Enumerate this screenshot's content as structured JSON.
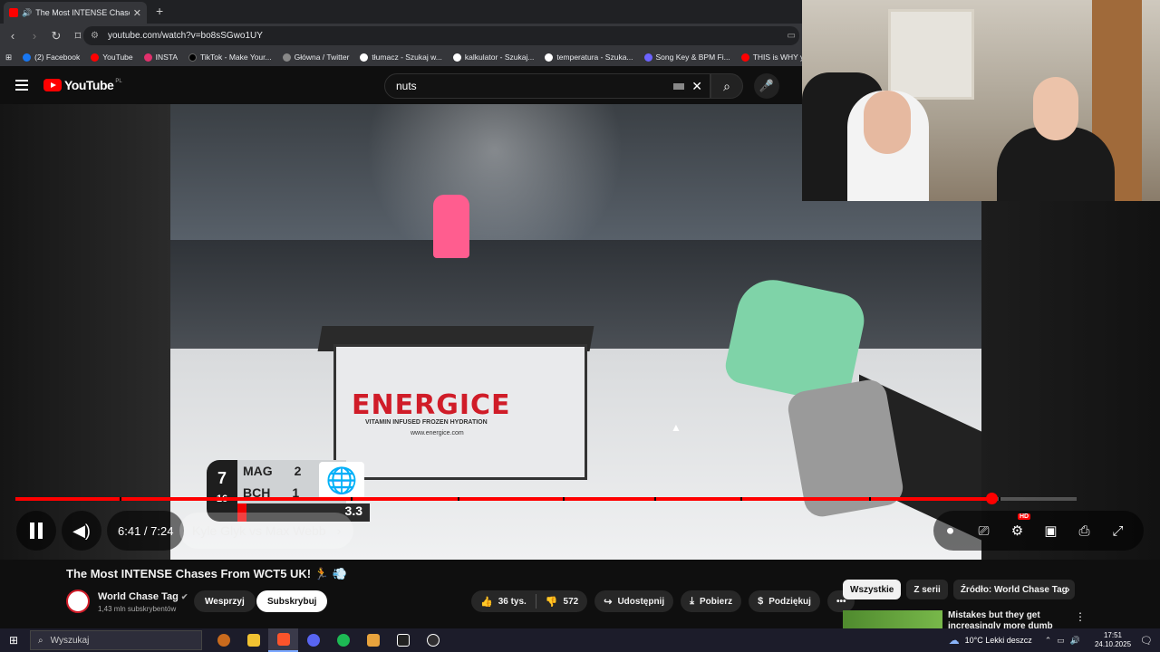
{
  "browser": {
    "tab_title": "The Most INTENSE Chases Fr",
    "url": "youtube.com/watch?v=bo8sSGwo1UY",
    "bookmarks": [
      {
        "label": "(2) Facebook",
        "color": "#1877f2"
      },
      {
        "label": "YouTube",
        "color": "#ff0000"
      },
      {
        "label": "INSTA",
        "color": "#e1306c"
      },
      {
        "label": "TikTok - Make Your...",
        "color": "#000000"
      },
      {
        "label": "Główna / Twitter",
        "color": "#888888"
      },
      {
        "label": "tłumacz - Szukaj w...",
        "color": "#ffffff"
      },
      {
        "label": "kalkulator - Szukaj...",
        "color": "#ffffff"
      },
      {
        "label": "temperatura - Szuka...",
        "color": "#ffffff"
      },
      {
        "label": "Song Key & BPM Fi...",
        "color": "#6c63ff"
      },
      {
        "label": "THIS is WHY your",
        "color": "#ff0000"
      }
    ]
  },
  "youtube": {
    "logo_text": "YouTube",
    "region": "PL",
    "search_value": "nuts"
  },
  "video": {
    "scoreboard": {
      "round": "7",
      "sub": "16",
      "team1": "MAG",
      "score1": "2",
      "team2": "BCH",
      "score2": "1",
      "timer": "3.3"
    },
    "sign_text": "ENERGICE",
    "sign_sub": "VITAMIN INFUSED FROZEN HYDRATION",
    "sign_url": "www.energice.com",
    "progress": 0.9197,
    "time_display": "6:41 / 7:24",
    "chapter": "Kyle Glyk vs Max Webb",
    "hd_badge": "HD"
  },
  "details": {
    "title": "The Most INTENSE Chases From WCT5 UK! 🏃 💨",
    "channel": "World Chase Tag",
    "subscribers": "1,43 mln subskrybentów",
    "join_label": "Wesprzyj",
    "subscribe_label": "Subskrybuj",
    "likes": "36 tys.",
    "dislikes": "572",
    "share_label": "Udostępnij",
    "download_label": "Pobierz",
    "thanks_label": "Podziękuj"
  },
  "sidebar": {
    "chips": [
      "Wszystkie",
      "Z serii",
      "Źródło: World Chase Tag"
    ],
    "rec_title": "Mistakes but they get increasingly more dumb"
  },
  "taskbar": {
    "search_placeholder": "Wyszukaj",
    "weather": "10°C  Lekki deszcz",
    "time": "17:51",
    "date": "24.10.2025"
  }
}
